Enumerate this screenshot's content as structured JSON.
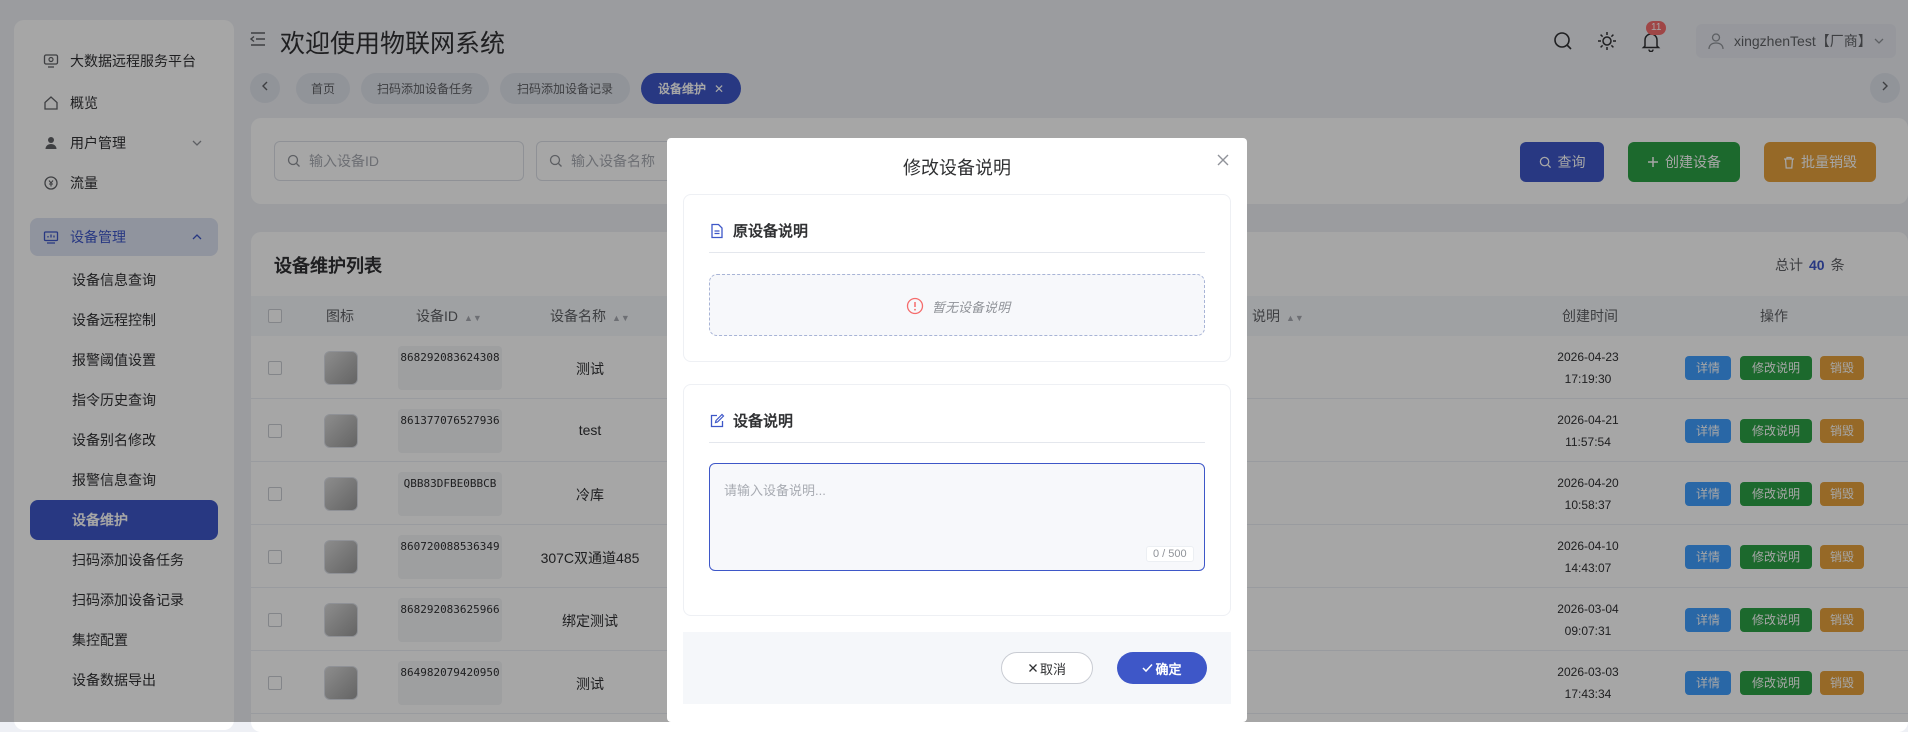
{
  "sidebar": {
    "items": [
      {
        "label": "大数据远程服务平台",
        "icon": "monitor-icon"
      },
      {
        "label": "概览",
        "icon": "home-icon"
      },
      {
        "label": "用户管理",
        "icon": "user-icon"
      },
      {
        "label": "流量",
        "icon": "coin-icon"
      },
      {
        "label": "设备管理",
        "icon": "device-icon"
      }
    ],
    "sub_items": [
      "设备信息查询",
      "设备远程控制",
      "报警阈值设置",
      "指令历史查询",
      "设备别名修改",
      "报警信息查询",
      "设备维护",
      "扫码添加设备任务",
      "扫码添加设备记录",
      "集控配置",
      "设备数据导出"
    ]
  },
  "header": {
    "title": "欢迎使用物联网系统",
    "badge_count": "11",
    "username": "xingzhenTest【厂商】"
  },
  "tabs": [
    {
      "label": "首页"
    },
    {
      "label": "扫码添加设备任务"
    },
    {
      "label": "扫码添加设备记录"
    },
    {
      "label": "设备维护",
      "close": "✕"
    }
  ],
  "search": {
    "device_id_placeholder": "输入设备ID",
    "device_name_placeholder": "输入设备名称",
    "query_label": "查询",
    "create_label": "创建设备",
    "batch_cancel_label": "批量销毁"
  },
  "table": {
    "title": "设备维护列表",
    "total_prefix": "总计",
    "total_count": "40",
    "total_suffix": "条",
    "headers": {
      "icon": "图标",
      "device_id": "设备ID",
      "device_name": "设备名称",
      "desc": "说明",
      "created": "创建时间",
      "ops": "操作"
    },
    "rows": [
      {
        "id": "868292083624308",
        "name": "测试",
        "date": "2026-04-23",
        "time": "17:19:30"
      },
      {
        "id": "861377076527936",
        "name": "test",
        "date": "2026-04-21",
        "time": "11:57:54"
      },
      {
        "id": "QBB83DFBE0BBCB",
        "name": "冷库",
        "date": "2026-04-20",
        "time": "10:58:37"
      },
      {
        "id": "860720088536349",
        "name": "307C双通道485",
        "date": "2026-04-10",
        "time": "14:43:07"
      },
      {
        "id": "868292083625966",
        "name": "绑定测试",
        "date": "2026-03-04",
        "time": "09:07:31"
      },
      {
        "id": "864982079420950",
        "name": "测试",
        "date": "2026-03-03",
        "time": "17:43:34"
      }
    ],
    "op_labels": {
      "detail": "详情",
      "edit": "修改说明",
      "destroy": "销毁"
    }
  },
  "dialog": {
    "title": "修改设备说明",
    "original_heading": "原设备说明",
    "empty_text": "暂无设备说明",
    "desc_heading": "设备说明",
    "textarea_placeholder": "请输入设备说明...",
    "counter": "0 / 500",
    "cancel_label": "取消",
    "confirm_label": "确定"
  },
  "colors": {
    "primary": "#3e57c8",
    "success": "#2ba245",
    "warning": "#e6a23c",
    "info": "#409eff",
    "danger": "#f56c6c"
  }
}
